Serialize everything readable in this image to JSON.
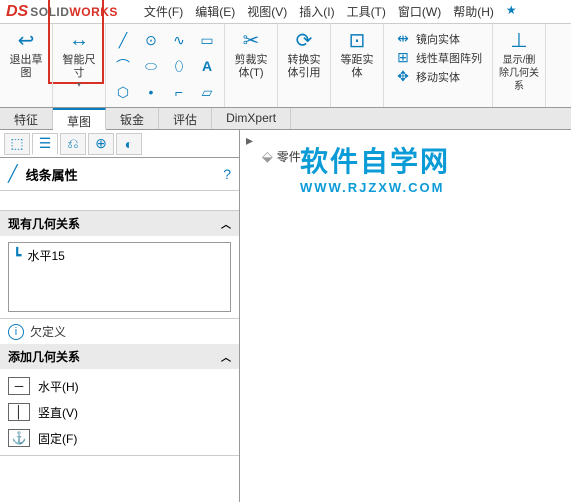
{
  "logo": {
    "brand1": "SOLID",
    "brand2": "WORKS"
  },
  "menu": [
    "文件(F)",
    "编辑(E)",
    "视图(V)",
    "插入(I)",
    "工具(T)",
    "窗口(W)",
    "帮助(H)"
  ],
  "ribbon": {
    "exit_sketch": "退出草图",
    "smart_dim": "智能尺寸",
    "trim": "剪裁实体(T)",
    "convert": "转换实体引用",
    "offset": "等距实体",
    "mirror": "镜向实体",
    "pattern": "线性草图阵列",
    "move": "移动实体",
    "display": "显示/删除几何关系"
  },
  "tabs": [
    "特征",
    "草图",
    "钣金",
    "评估",
    "DimXpert"
  ],
  "active_tab": "草图",
  "prop": {
    "title": "线条属性",
    "existing_rel": "现有几何关系",
    "rel_item": "水平15",
    "status": "欠定义",
    "add_rel": "添加几何关系",
    "options": {
      "horizontal": "水平(H)",
      "vertical": "竖直(V)",
      "fix": "固定(F)"
    }
  },
  "tree": {
    "part": "零件"
  },
  "watermark": {
    "big": "软件自学网",
    "url": "WWW.RJZXW.COM"
  }
}
